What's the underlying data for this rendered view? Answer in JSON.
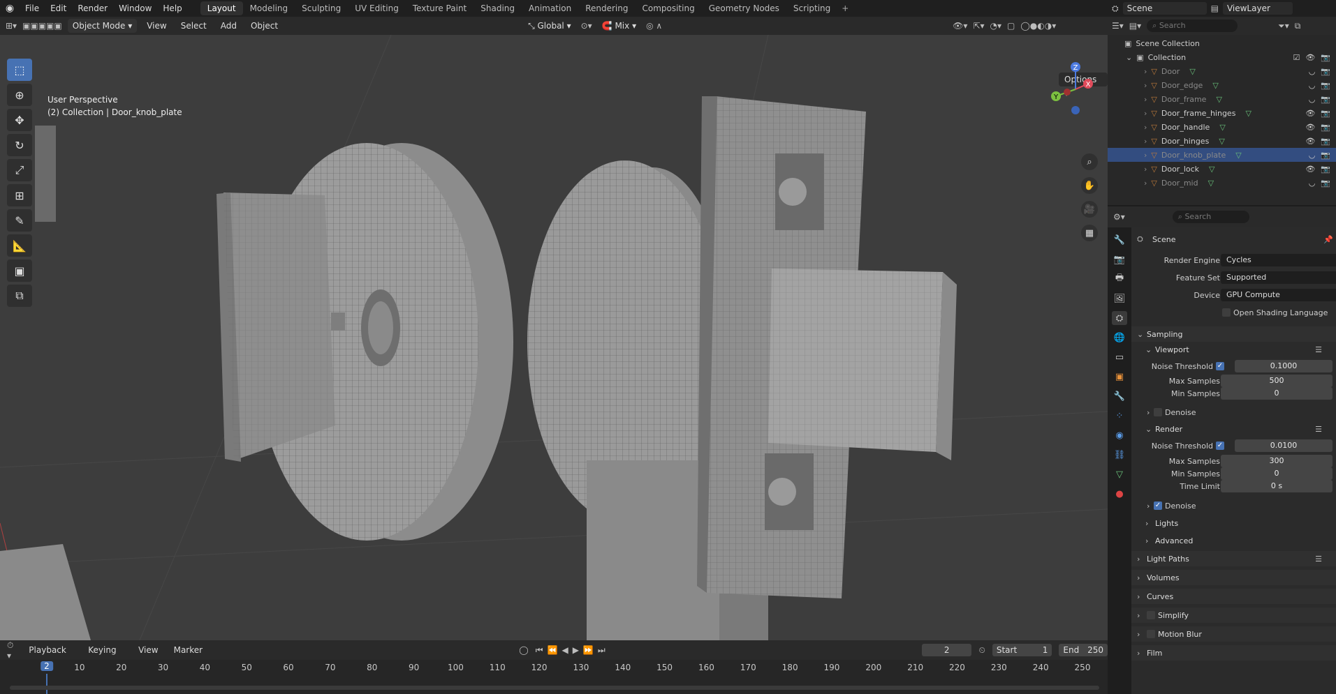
{
  "topbar": {
    "menus": [
      "File",
      "Edit",
      "Render",
      "Window",
      "Help"
    ],
    "workspaces": [
      "Layout",
      "Modeling",
      "Sculpting",
      "UV Editing",
      "Texture Paint",
      "Shading",
      "Animation",
      "Rendering",
      "Compositing",
      "Geometry Nodes",
      "Scripting"
    ],
    "active_workspace": "Layout",
    "scene": "Scene",
    "view_layer": "ViewLayer"
  },
  "viewport_header": {
    "mode": "Object Mode",
    "menus": [
      "View",
      "Select",
      "Add",
      "Object"
    ],
    "orientation": "Global",
    "snap_mode": "Mix"
  },
  "viewport": {
    "perspective": "User Perspective",
    "context": "(2) Collection | Door_knob_plate",
    "options_label": "Options",
    "gizmo_axes": [
      "Z",
      "Y",
      "X"
    ]
  },
  "timeline": {
    "menus": [
      "Playback",
      "Keying",
      "View",
      "Marker"
    ],
    "current_frame": "2",
    "start_label": "Start",
    "start": "1",
    "end_label": "End",
    "end": "250",
    "ticks": [
      "10",
      "20",
      "30",
      "40",
      "50",
      "60",
      "70",
      "80",
      "90",
      "100",
      "110",
      "120",
      "130",
      "140",
      "150",
      "160",
      "170",
      "180",
      "190",
      "200",
      "210",
      "220",
      "230",
      "240",
      "250"
    ]
  },
  "outliner": {
    "search_placeholder": "Search",
    "scene_collection": "Scene Collection",
    "collection": "Collection",
    "items": [
      {
        "name": "Door",
        "visible": false
      },
      {
        "name": "Door_edge",
        "visible": false
      },
      {
        "name": "Door_frame",
        "visible": false
      },
      {
        "name": "Door_frame_hinges",
        "visible": true
      },
      {
        "name": "Door_handle",
        "visible": true
      },
      {
        "name": "Door_hinges",
        "visible": true
      },
      {
        "name": "Door_knob_plate",
        "visible": false,
        "selected": true
      },
      {
        "name": "Door_lock",
        "visible": true
      },
      {
        "name": "Door_mid",
        "visible": false
      }
    ]
  },
  "properties": {
    "search_placeholder": "Search",
    "context": "Scene",
    "render_engine_label": "Render Engine",
    "render_engine": "Cycles",
    "feature_set_label": "Feature Set",
    "feature_set": "Supported",
    "device_label": "Device",
    "device": "GPU Compute",
    "osl_label": "Open Shading Language",
    "sampling": "Sampling",
    "viewport": "Viewport",
    "noise_threshold_label": "Noise Threshold",
    "viewport_noise_threshold": "0.1000",
    "max_samples_label": "Max Samples",
    "viewport_max_samples": "500",
    "min_samples_label": "Min Samples",
    "viewport_min_samples": "0",
    "denoise_label": "Denoise",
    "render": "Render",
    "render_noise_threshold": "0.0100",
    "render_max_samples": "300",
    "render_min_samples": "0",
    "time_limit_label": "Time Limit",
    "time_limit": "0 s",
    "lights": "Lights",
    "advanced": "Advanced",
    "light_paths": "Light Paths",
    "volumes": "Volumes",
    "curves": "Curves",
    "simplify": "Simplify",
    "motion_blur": "Motion Blur",
    "film": "Film"
  }
}
